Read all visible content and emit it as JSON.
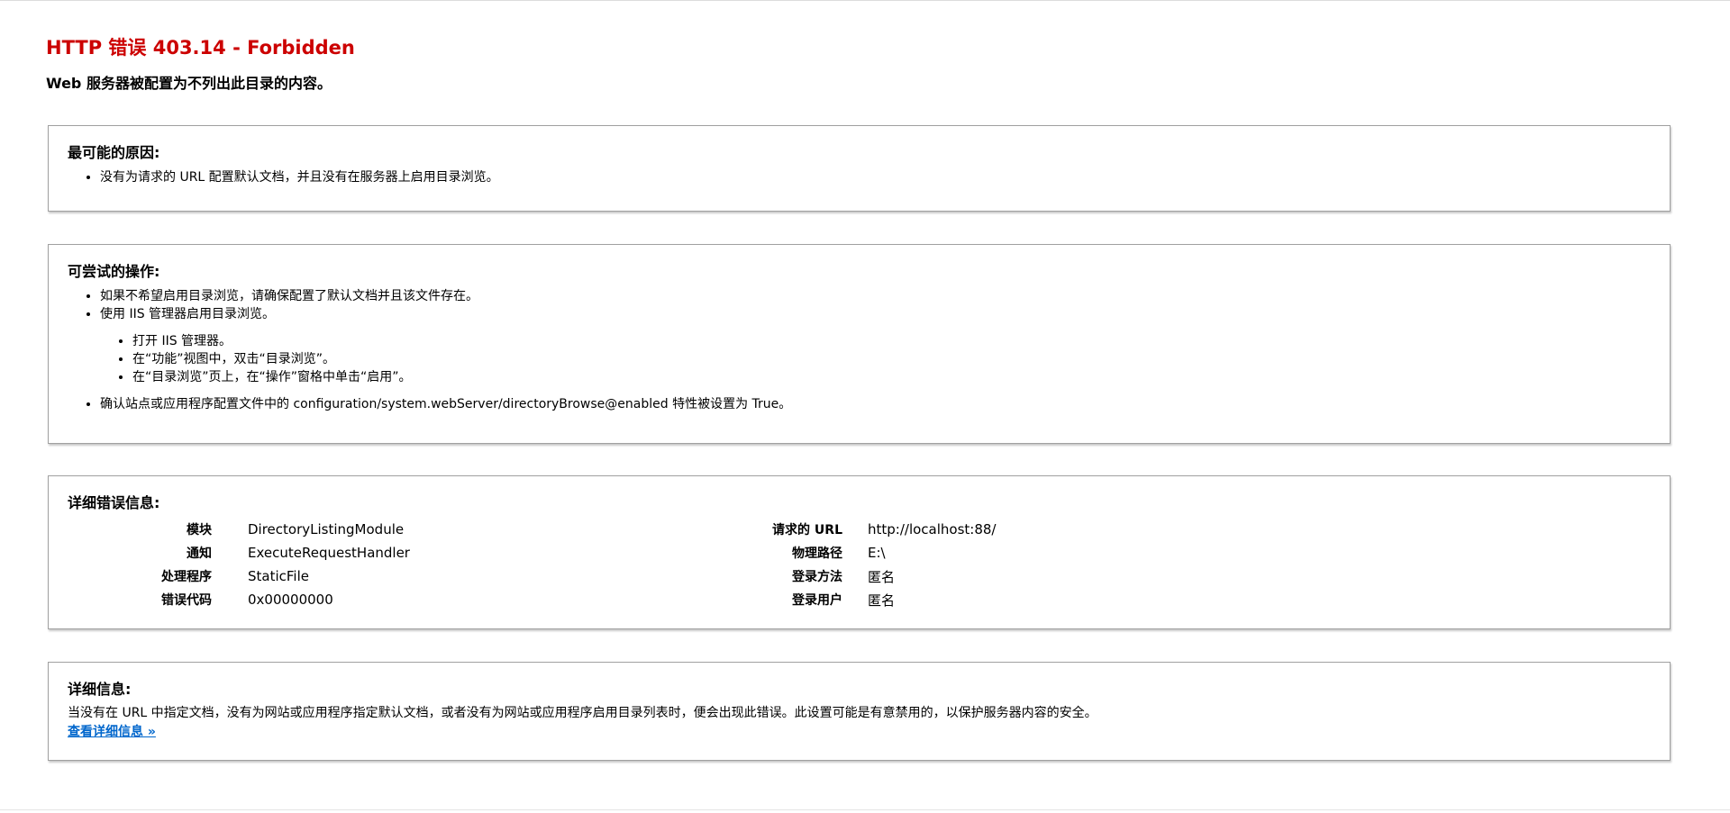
{
  "header": {
    "title": "HTTP 错误 403.14 - Forbidden",
    "subtitle": "Web 服务器被配置为不列出此目录的内容。"
  },
  "reasons": {
    "heading": "最可能的原因:",
    "items": [
      "没有为请求的 URL 配置默认文档，并且没有在服务器上启用目录浏览。"
    ]
  },
  "actions": {
    "heading": "可尝试的操作:",
    "bullet_1": "如果不希望启用目录浏览，请确保配置了默认文档并且该文件存在。",
    "bullet_2": "使用 IIS 管理器启用目录浏览。",
    "steps": [
      "打开 IIS 管理器。",
      "在“功能”视图中，双击“目录浏览”。",
      "在“目录浏览”页上，在“操作”窗格中单击“启用”。"
    ],
    "bullet_3": "确认站点或应用程序配置文件中的 configuration/system.webServer/directoryBrowse@enabled 特性被设置为 True。"
  },
  "error_details": {
    "heading": "详细错误信息:",
    "left": [
      {
        "label": "模块",
        "value": "DirectoryListingModule"
      },
      {
        "label": "通知",
        "value": "ExecuteRequestHandler"
      },
      {
        "label": "处理程序",
        "value": "StaticFile"
      },
      {
        "label": "错误代码",
        "value": "0x00000000"
      }
    ],
    "right": [
      {
        "label": "请求的 URL",
        "value": "http://localhost:88/"
      },
      {
        "label": "物理路径",
        "value": "E:\\"
      },
      {
        "label": "登录方法",
        "value": "匿名"
      },
      {
        "label": "登录用户",
        "value": "匿名"
      }
    ]
  },
  "more_info": {
    "heading": "详细信息:",
    "text": "当没有在 URL 中指定文档，没有为网站或应用程序指定默认文档，或者没有为网站或应用程序启用目录列表时，便会出现此错误。此设置可能是有意禁用的，以保护服务器内容的安全。",
    "link": "查看详细信息 »"
  },
  "colors": {
    "title": "#cc0000",
    "link": "#0066cc",
    "border": "#a0a0a0"
  }
}
